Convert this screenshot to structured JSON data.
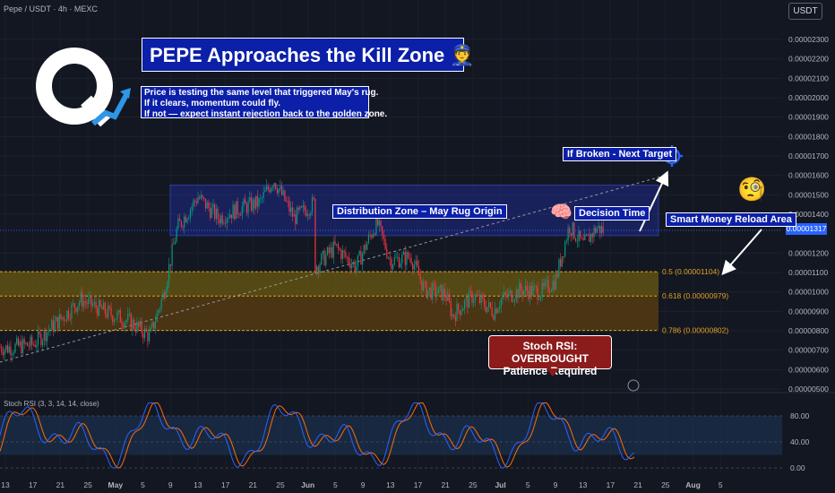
{
  "header": {
    "symbol": "Pepe / USDT · 4h · MEXC",
    "currency": "USDT"
  },
  "annotations": {
    "headline": "PEPE Approaches the Kill Zone 👮",
    "info_lines": [
      "Price is testing the same level that triggered May's rug.",
      "If it clears, momentum could fly.",
      "If not — expect instant rejection back to the golden zone."
    ],
    "next_target": "If Broken - Next Target",
    "distribution_zone": "Distribution Zone – May Rug Origin",
    "decision_time": "Decision Time",
    "smart_money": "Smart Money Reload Area",
    "stoch_warning_1": "Stoch RSI: OVERBOUGHT",
    "stoch_warning_2": "Patience Required",
    "brain_emoji": "🧠",
    "monocle_emoji": "🧐"
  },
  "colors": {
    "background": "#131722",
    "zone_fill": "#1e2a8a",
    "zone_border": "#3d5afe",
    "fib_fill": "#5a4a12",
    "fib_line": "#e0a020",
    "price_line": "#2962ff",
    "up": "#089981",
    "down": "#f23645",
    "stoch_k": "#2962ff",
    "stoch_d": "#ff6d00"
  },
  "chart_data": {
    "type": "line",
    "title": "PEPE Approaches the Kill Zone",
    "ylim": [
      4.5e-06,
      2.4e-06
    ],
    "y_ticks": [
      "0.00002300",
      "0.00002200",
      "0.00002100",
      "0.00002000",
      "0.00001900",
      "0.00001800",
      "0.00001700",
      "0.00001600",
      "0.00001500",
      "0.00001400",
      "0.00001317",
      "0.00001200",
      "0.00001100",
      "0.00001000",
      "0.00000900",
      "0.00000800",
      "0.00000700",
      "0.00000600",
      "0.00000500"
    ],
    "y_tick_values": [
      23,
      22,
      21,
      20,
      19,
      18,
      17,
      16,
      15,
      14,
      13.17,
      12,
      11,
      10,
      9,
      8,
      7,
      6,
      5
    ],
    "current_price": "0.00001317",
    "current_price_value": 13.17,
    "x_ticks": [
      "13",
      "17",
      "21",
      "25",
      "May",
      "5",
      "9",
      "13",
      "17",
      "21",
      "25",
      "Jun",
      "5",
      "9",
      "13",
      "17",
      "21",
      "25",
      "Jul",
      "5",
      "9",
      "13",
      "17",
      "21",
      "25",
      "Aug",
      "5"
    ],
    "distribution_zone": {
      "low": 12.9,
      "high": 15.5
    },
    "fib_levels": [
      {
        "label": "0.5 (0.00001104)",
        "value": 11.04
      },
      {
        "label": "0.618 (0.00000979)",
        "value": 9.79
      },
      {
        "label": "0.786 (0.00000802)",
        "value": 8.02
      }
    ],
    "price_series": [
      [
        "Apr 10",
        7.4
      ],
      [
        "Apr 14",
        7.1
      ],
      [
        "Apr 18",
        7.3
      ],
      [
        "Apr 22",
        8.6
      ],
      [
        "Apr 25",
        9.6
      ],
      [
        "Apr 29",
        8.9
      ],
      [
        "May 3",
        8.5
      ],
      [
        "May 6",
        7.7
      ],
      [
        "May 8",
        9.9
      ],
      [
        "May 10",
        13.3
      ],
      [
        "May 13",
        14.9
      ],
      [
        "May 16",
        13.8
      ],
      [
        "May 19",
        14.3
      ],
      [
        "May 22",
        14.6
      ],
      [
        "May 24",
        15.8
      ],
      [
        "May 27",
        13.8
      ],
      [
        "May 30",
        14.6
      ],
      [
        "Jun 2",
        11.3
      ],
      [
        "Jun 5",
        12.3
      ],
      [
        "Jun 8",
        11.3
      ],
      [
        "Jun 11",
        13.6
      ],
      [
        "Jun 13",
        11.6
      ],
      [
        "Jun 16",
        11.8
      ],
      [
        "Jun 18",
        10.1
      ],
      [
        "Jun 21",
        9.9
      ],
      [
        "Jun 22",
        8.8
      ],
      [
        "Jun 25",
        9.8
      ],
      [
        "Jun 28",
        9.0
      ],
      [
        "Jul 1",
        9.6
      ],
      [
        "Jul 4",
        10.1
      ],
      [
        "Jul 7",
        10.0
      ],
      [
        "Jul 9",
        10.6
      ],
      [
        "Jul 11",
        13.4
      ],
      [
        "Jul 13",
        12.4
      ],
      [
        "Jul 15",
        13.3
      ],
      [
        "Jul 16",
        13.17
      ]
    ],
    "stoch_rsi": {
      "label": "Stoch RSI (3, 3, 14, 14, close)",
      "levels": [
        "80.00",
        "40.00",
        "0.00"
      ],
      "level_values": [
        80,
        40,
        0
      ],
      "ylim": [
        0,
        100
      ]
    }
  }
}
